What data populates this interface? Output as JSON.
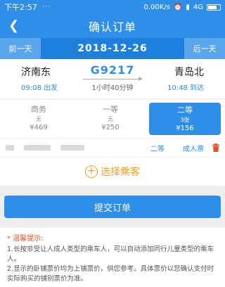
{
  "status": {
    "time": "下午2:57",
    "dots": "···",
    "speed": "0.00K/s",
    "network": "4G"
  },
  "nav": {
    "title": "确认订单"
  },
  "datebar": {
    "prev": "前一天",
    "date": "2018-12-26",
    "next": "后一天"
  },
  "train": {
    "from_station": "济南东",
    "from_time": "09:08 出发",
    "number": "G9217",
    "duration": "1小时40分钟",
    "to_station": "青岛北",
    "to_time": "10:48 到达"
  },
  "seats": [
    {
      "name": "商务",
      "avail": "无",
      "price": "¥469",
      "selected": false
    },
    {
      "name": "一等",
      "avail": "无",
      "price": "¥250",
      "selected": false
    },
    {
      "name": "二等",
      "avail": "3张",
      "price": "¥156",
      "selected": true
    }
  ],
  "passenger": {
    "seat": "二等",
    "type": "成人票"
  },
  "add_passenger": {
    "label": "选择乘客",
    "plus": "+"
  },
  "submit": {
    "label": "提交订单"
  },
  "tips": {
    "title": "* 温馨提示:",
    "lines": [
      "1.长按非受让人成人类型的乘车人，可以自动添加同行儿童类型的乘车人。",
      "2.显示的卧铺票价均为上铺票价，供您参考。具体票价以您确认支付时实际购买的铺别票价为准。"
    ]
  },
  "colors": {
    "primary": "#2f8fe8",
    "accent": "#f0a020",
    "warning": "#e0542a"
  }
}
